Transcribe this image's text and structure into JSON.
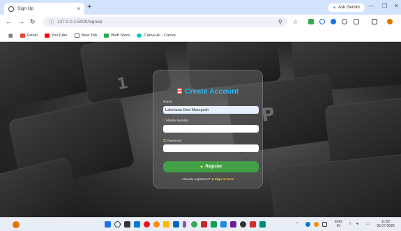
{
  "tab": {
    "title": "Sign Up",
    "close": "×",
    "new_tab": "+"
  },
  "gemini": {
    "label": "Ask Gemini",
    "icon": "sparkle-icon"
  },
  "window_controls": {
    "minimize": "—",
    "maximize": "❐",
    "close": "✕"
  },
  "toolbar": {
    "url": "127.0.0.1:5000/signup",
    "icons": [
      "back-arrow-icon",
      "forward-arrow-icon",
      "reload-icon",
      "site-info-icon",
      "zoom-icon",
      "star-icon"
    ]
  },
  "bookmarks": [
    {
      "label": "Gmail",
      "icon": "gmail-icon",
      "color": "#ea4335"
    },
    {
      "label": "YouTube",
      "icon": "youtube-icon",
      "color": "#ff0000"
    },
    {
      "label": "New Tab",
      "icon": "new-tab-icon",
      "color": "#5f6368"
    },
    {
      "label": "Web Store",
      "icon": "web-store-icon",
      "color": "#34a853"
    },
    {
      "label": "Canva AI - Canva",
      "icon": "canva-icon",
      "color": "#00c4cc"
    }
  ],
  "form": {
    "title": "Create Account",
    "title_icon": "document-icon",
    "name_label": "Name",
    "name_value": "Lakshana Devi Murugesh",
    "mobile_label": "Mobile Number",
    "mobile_icon": "phone-icon",
    "mobile_value": "",
    "password_label": "Password",
    "password_icon": "key-icon",
    "password_value": "",
    "register_label": "Register",
    "register_icon": "sparkle-icon",
    "signin_prompt": "Already registered?",
    "signin_link": "Sign in here",
    "signin_icon": "lock-icon",
    "accent_color": "#29b6f6",
    "button_color": "#43a047",
    "link_color": "#ffca28"
  },
  "taskbar": {
    "language": "ENG",
    "region": "IN",
    "time": "11:52",
    "date": "05-07-2025"
  }
}
